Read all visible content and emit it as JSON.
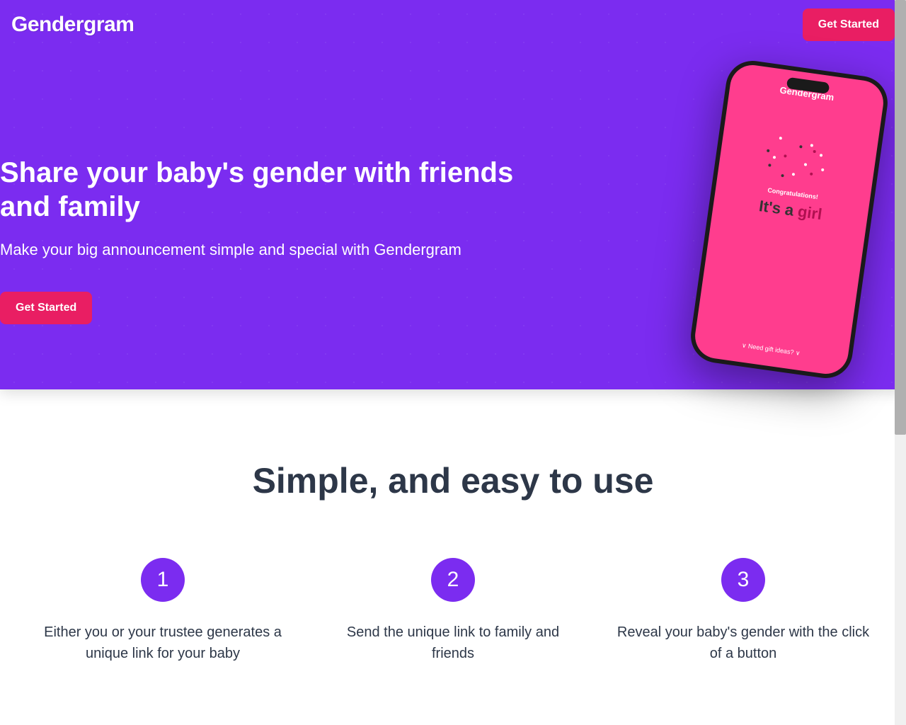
{
  "brand": {
    "name": "Gendergram"
  },
  "nav": {
    "cta_label": "Get Started"
  },
  "hero": {
    "title": "Share your baby's gender with friends and family",
    "subtitle": "Make your big announcement simple and special with Gendergram",
    "cta_label": "Get Started"
  },
  "phone": {
    "logo": "Gendergram",
    "congrats": "Congratulations!",
    "reveal_prefix": "It's a",
    "reveal_gender": "girl",
    "footer": "∨   Need gift ideas?   ∨"
  },
  "features": {
    "title": "Simple, and easy to use",
    "steps": [
      {
        "number": "1",
        "description": "Either you or your trustee generates a unique link for your baby"
      },
      {
        "number": "2",
        "description": "Send the unique link to family and friends"
      },
      {
        "number": "3",
        "description": "Reveal your baby's gender with the click of a button"
      }
    ]
  },
  "colors": {
    "primary": "#7b2cf0",
    "accent": "#e91e63",
    "phone_pink": "#ff3d8e"
  }
}
